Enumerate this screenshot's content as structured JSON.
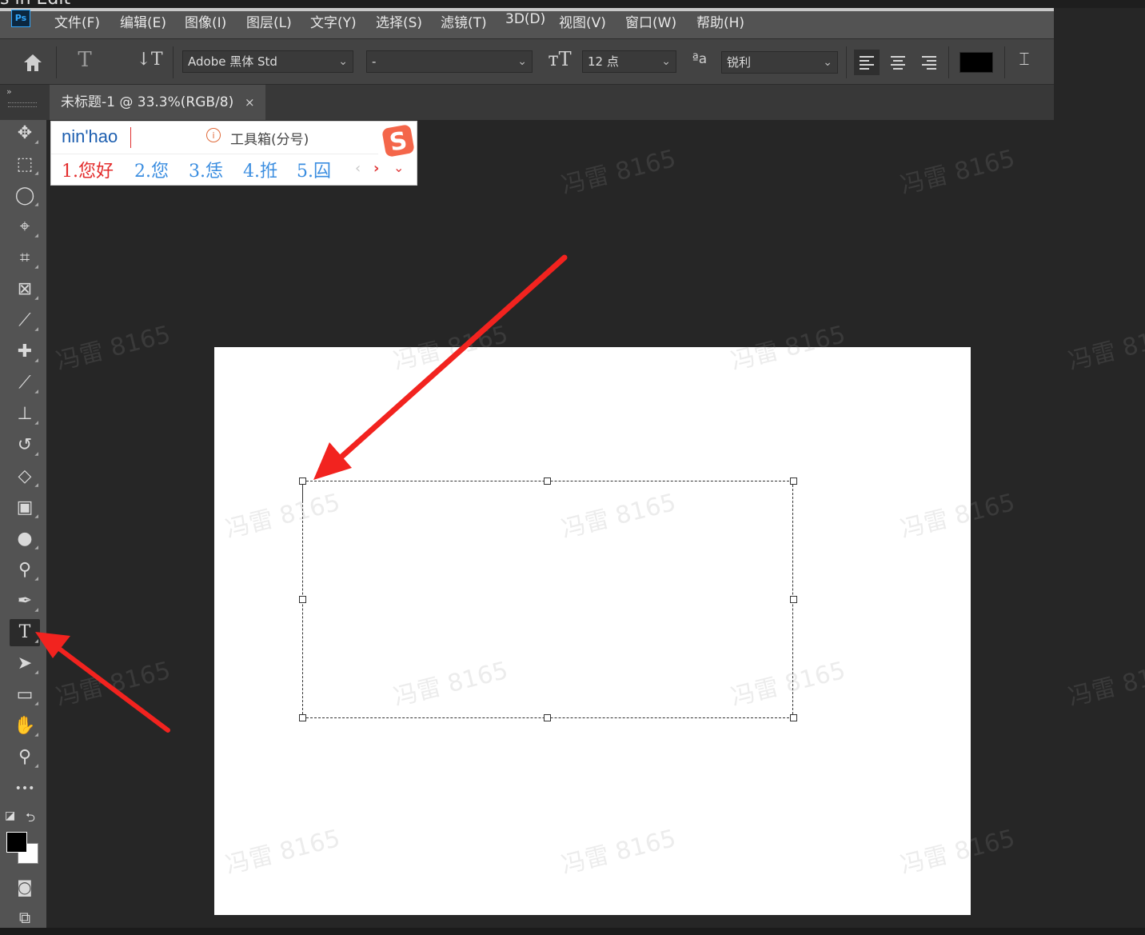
{
  "top_strip_text": "s in Edit",
  "app": {
    "logo": "Ps"
  },
  "menu": [
    "文件(F)",
    "编辑(E)",
    "图像(I)",
    "图层(L)",
    "文字(Y)",
    "选择(S)",
    "滤镜(T)",
    "3D(D)",
    "视图(V)",
    "窗口(W)",
    "帮助(H)"
  ],
  "options": {
    "font_family": "Adobe 黑体 Std",
    "font_style": "-",
    "font_size": "12 点",
    "antialias_icon_text": "ªa",
    "antialias": "锐利",
    "text_color": "#000000"
  },
  "document_tab": {
    "title": "未标题-1 @ 33.3%(RGB/8)",
    "close": "×"
  },
  "ime": {
    "input": "nin'hao",
    "hint": "工具箱(分号)",
    "hint_icon": "i",
    "candidates": [
      "1.您好",
      "2.您",
      "3.恁",
      "4.拰",
      "5.囜"
    ],
    "prev": "‹",
    "next": "›",
    "more": "⌄"
  },
  "tools": [
    {
      "name": "move-tool",
      "glyph": "✥"
    },
    {
      "name": "marquee-tool",
      "glyph": "⬚"
    },
    {
      "name": "lasso-tool",
      "glyph": "◯"
    },
    {
      "name": "quick-selection-tool",
      "glyph": "⌖"
    },
    {
      "name": "crop-tool",
      "glyph": "⌗"
    },
    {
      "name": "frame-tool",
      "glyph": "⊠"
    },
    {
      "name": "eyedropper-tool",
      "glyph": "⟋"
    },
    {
      "name": "healing-brush-tool",
      "glyph": "✚"
    },
    {
      "name": "brush-tool",
      "glyph": "⟋"
    },
    {
      "name": "clone-stamp-tool",
      "glyph": "⊥"
    },
    {
      "name": "history-brush-tool",
      "glyph": "↺"
    },
    {
      "name": "eraser-tool",
      "glyph": "◇"
    },
    {
      "name": "gradient-tool",
      "glyph": "▣"
    },
    {
      "name": "blur-tool",
      "glyph": "●"
    },
    {
      "name": "dodge-tool",
      "glyph": "⚲"
    },
    {
      "name": "pen-tool",
      "glyph": "✒"
    },
    {
      "name": "type-tool",
      "glyph": "T",
      "active": true
    },
    {
      "name": "path-selection-tool",
      "glyph": "➤"
    },
    {
      "name": "rectangle-tool",
      "glyph": "▭"
    },
    {
      "name": "hand-tool",
      "glyph": "✋"
    },
    {
      "name": "zoom-tool",
      "glyph": "⚲"
    },
    {
      "name": "more-tools",
      "glyph": "•••"
    }
  ],
  "colors": {
    "foreground": "#000000",
    "background": "#ffffff",
    "annotation_arrow": "#f2231f"
  },
  "watermark": "冯雷 8165"
}
